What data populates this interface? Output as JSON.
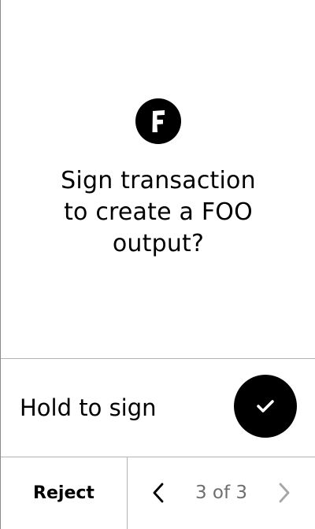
{
  "review": {
    "app_icon": "f-logo-icon",
    "title": "Sign transaction\nto create a FOO\noutput?"
  },
  "confirm": {
    "hold_label": "Hold to sign",
    "button_icon": "checkmark-icon"
  },
  "footer": {
    "reject_label": "Reject",
    "prev_icon": "chevron-left-icon",
    "next_icon": "chevron-right-icon",
    "page_indicator": "3 of 3",
    "current_page": 3,
    "total_pages": 3
  },
  "colors": {
    "background": "#ffffff",
    "foreground": "#000000",
    "divider": "#b3b3b3",
    "muted_text": "#6e6e6e",
    "disabled_icon": "#a6a6a6"
  }
}
